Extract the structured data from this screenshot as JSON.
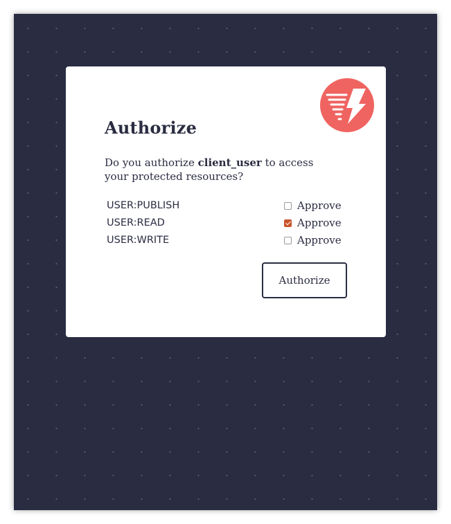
{
  "dialog": {
    "title": "Authorize",
    "prompt_prefix": "Do you authorize ",
    "client_name": "client_user",
    "prompt_suffix": " to access your protected resources?",
    "scopes": [
      {
        "name": "USER:PUBLISH",
        "approve_label": "Approve",
        "checked": false
      },
      {
        "name": "USER:READ",
        "approve_label": "Approve",
        "checked": true
      },
      {
        "name": "USER:WRITE",
        "approve_label": "Approve",
        "checked": false
      }
    ],
    "submit_label": "Authorize"
  },
  "colors": {
    "background": "#2a2c41",
    "card": "#ffffff",
    "logo": "#ef6461",
    "checkbox_checked": "#c9552b",
    "text": "#2a2c41"
  },
  "icons": {
    "logo": "lightning-bolt-logo-icon"
  }
}
